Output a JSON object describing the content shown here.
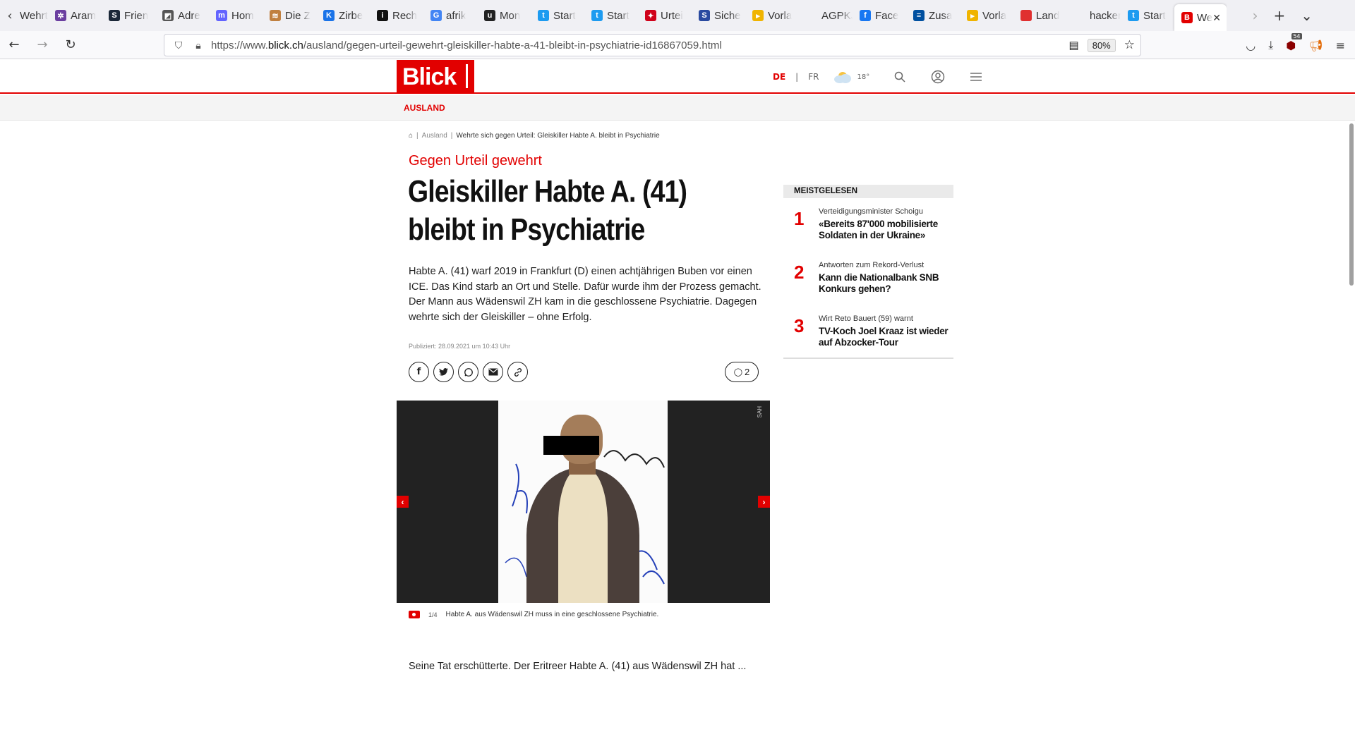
{
  "browser": {
    "tabs": [
      {
        "label": "Wehrte",
        "fav_text": "",
        "fav_color": "#e0e0e0",
        "name": "tab-1"
      },
      {
        "label": "Aram",
        "fav_text": "✲",
        "fav_color": "#6b3fa0",
        "name": "tab-2"
      },
      {
        "label": "Frien",
        "fav_text": "S",
        "fav_color": "#1b2838",
        "name": "tab-3"
      },
      {
        "label": "Adre",
        "fav_text": "◩",
        "fav_color": "#555555",
        "name": "tab-4"
      },
      {
        "label": "Hom",
        "fav_text": "m",
        "fav_color": "#6364ff",
        "name": "tab-5"
      },
      {
        "label": "Die Z",
        "fav_text": "≋",
        "fav_color": "#c08040",
        "name": "tab-6"
      },
      {
        "label": "Zirbe",
        "fav_text": "K",
        "fav_color": "#1a73e8",
        "name": "tab-7"
      },
      {
        "label": "Rech",
        "fav_text": "i",
        "fav_color": "#111111",
        "name": "tab-8"
      },
      {
        "label": "afrik",
        "fav_text": "G",
        "fav_color": "#4285f4",
        "name": "tab-9"
      },
      {
        "label": "Mon",
        "fav_text": "u",
        "fav_color": "#222222",
        "name": "tab-10"
      },
      {
        "label": "Start",
        "fav_text": "t",
        "fav_color": "#1d9bf0",
        "name": "tab-11"
      },
      {
        "label": "Start",
        "fav_text": "t",
        "fav_color": "#1d9bf0",
        "name": "tab-12"
      },
      {
        "label": "Urtei",
        "fav_text": "✦",
        "fav_color": "#d0021b",
        "name": "tab-13"
      },
      {
        "label": "Siche",
        "fav_text": "S",
        "fav_color": "#2a4aa0",
        "name": "tab-14"
      },
      {
        "label": "Vorla",
        "fav_text": "▸",
        "fav_color": "#f0b400",
        "name": "tab-15"
      },
      {
        "label": "AGPKJP",
        "fav_text": "",
        "fav_color": "#f0f0f4",
        "name": "tab-16"
      },
      {
        "label": "Face",
        "fav_text": "f",
        "fav_color": "#1877f2",
        "name": "tab-17"
      },
      {
        "label": "Zusa",
        "fav_text": "≡",
        "fav_color": "#0050a0",
        "name": "tab-18"
      },
      {
        "label": "Vorla",
        "fav_text": "▸",
        "fav_color": "#f0b400",
        "name": "tab-19"
      },
      {
        "label": "Land",
        "fav_text": "",
        "fav_color": "#e03030",
        "name": "tab-20"
      },
      {
        "label": "hackers",
        "fav_text": "",
        "fav_color": "#f0f0f4",
        "name": "tab-21"
      },
      {
        "label": "Start",
        "fav_text": "t",
        "fav_color": "#1d9bf0",
        "name": "tab-22"
      }
    ],
    "active_tab": {
      "label": "We",
      "fav_text": "B",
      "fav_color": "#e20000"
    },
    "url_prefix": "https://www.",
    "url_domain": "blick.ch",
    "url_path": "/ausland/gegen-urteil-gewehrt-gleiskiller-habte-a-41-bleibt-in-psychiatrie-id16867059.html",
    "zoom": "80%",
    "badge_count": "54"
  },
  "site": {
    "logo": "Blick",
    "lang_de": "DE",
    "lang_fr": "FR",
    "temperature": "18°",
    "section": "AUSLAND",
    "brand_color": "#e20000"
  },
  "article": {
    "breadcrumb_section": "Ausland",
    "breadcrumb_current": "Wehrte sich gegen Urteil: Gleiskiller Habte A. bleibt in Psychiatrie",
    "kicker": "Gegen Urteil gewehrt",
    "headline": "Gleiskiller Habte A. (41) bleibt in Psychiatrie",
    "lead": "Habte A. (41) warf 2019 in Frankfurt (D) einen achtjährigen Buben vor einen ICE. Das Kind starb an Ort und Stelle. Dafür wurde ihm der Prozess gemacht. Der Mann aus Wädenswil ZH kam in die geschlossene Psychiatrie. Dagegen wehrte sich der Gleiskiller – ohne Erfolg.",
    "published": "Publiziert: 28.09.2021 um 10:43 Uhr",
    "comment_count": "2",
    "photo_credit": "SAH",
    "image_counter": "1/4",
    "caption": "Habte A. aus Wädenswil ZH muss in eine geschlossene Psychiatrie.",
    "body_start": "Seine Tat erschütterte. Der Eritreer Habte A. (41) aus Wädenswil ZH hat ..."
  },
  "sidebar": {
    "header": "MEISTGELESEN",
    "items": [
      {
        "num": "1",
        "kicker": "Verteidigungsminister Schoigu",
        "title": "«Bereits 87'000 mobilisierte Soldaten in der Ukraine»"
      },
      {
        "num": "2",
        "kicker": "Antworten zum Rekord-Verlust",
        "title": "Kann die Nationalbank SNB Konkurs gehen?"
      },
      {
        "num": "3",
        "kicker": "Wirt Reto Bauert (59) warnt",
        "title": "TV-Koch Joel Kraaz ist wieder auf Abzocker-Tour"
      }
    ]
  }
}
